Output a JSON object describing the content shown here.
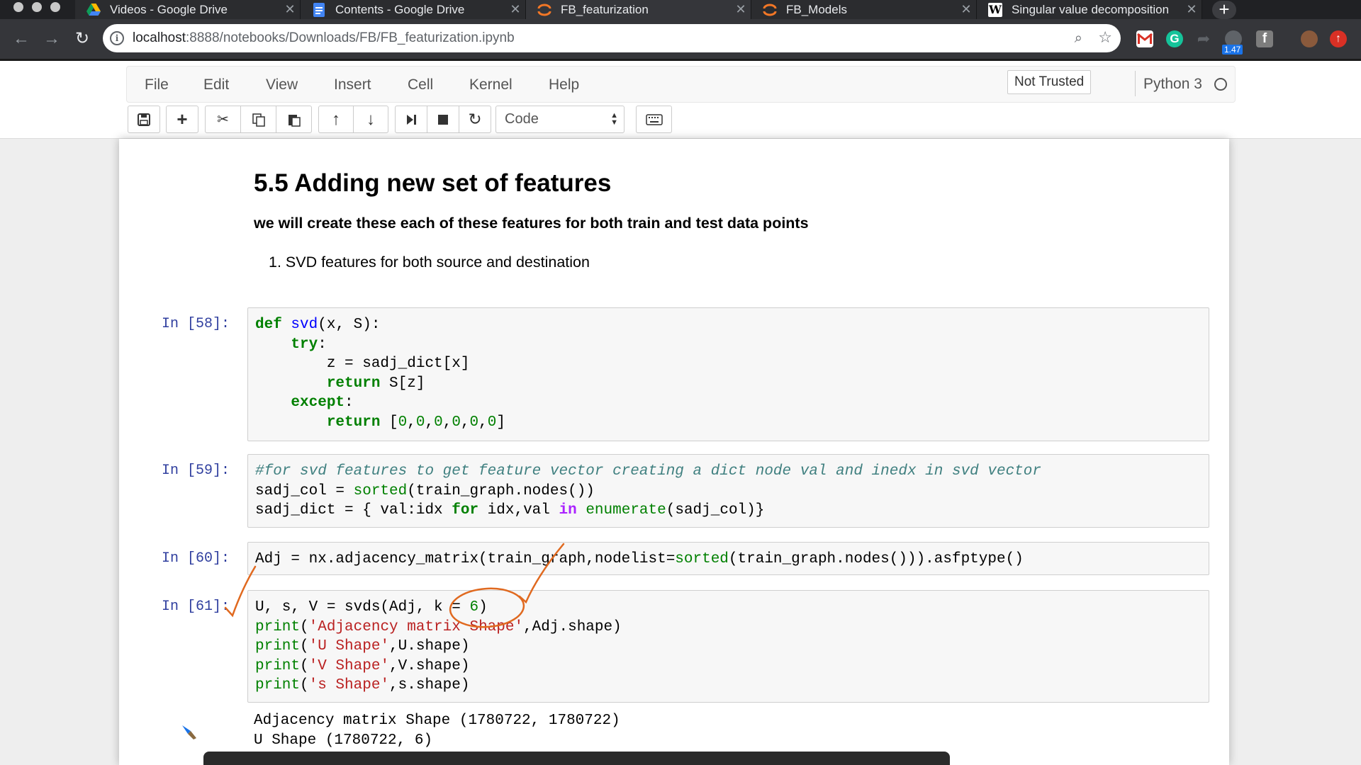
{
  "browser": {
    "tabs": [
      {
        "title": "Videos - Google Drive",
        "icon": "google-drive-icon",
        "active": false
      },
      {
        "title": "Contents - Google Drive",
        "icon": "google-docs-icon",
        "active": false
      },
      {
        "title": "FB_featurization",
        "icon": "jupyter-icon",
        "active": true
      },
      {
        "title": "FB_Models",
        "icon": "jupyter-icon",
        "active": false
      },
      {
        "title": "Singular value decomposition",
        "icon": "wikipedia-icon",
        "active": false
      }
    ],
    "url_host": "localhost",
    "url_rest": ":8888/notebooks/Downloads/FB/FB_featurization.ipynb",
    "extension_badge": "1.47"
  },
  "jupyter": {
    "menu": [
      "File",
      "Edit",
      "View",
      "Insert",
      "Cell",
      "Kernel",
      "Help"
    ],
    "trusted_label": "Not Trusted",
    "kernel_name": "Python 3",
    "cell_type": "Code"
  },
  "markdown": {
    "heading": "5.5 Adding new set of features",
    "bold_text": "we will create these each of these features for both train and test data points",
    "list_item": "1. SVD features for both source and destination"
  },
  "cells": [
    {
      "prompt": "In [58]:",
      "lines": [
        [
          [
            "kw",
            "def"
          ],
          [
            "t",
            " "
          ],
          [
            "fn",
            "svd"
          ],
          [
            "t",
            "(x, S):"
          ]
        ],
        [
          [
            "t",
            "    "
          ],
          [
            "kw",
            "try"
          ],
          [
            "t",
            ":"
          ]
        ],
        [
          [
            "t",
            "        z = sadj_dict[x]"
          ]
        ],
        [
          [
            "t",
            "        "
          ],
          [
            "kw",
            "return"
          ],
          [
            "t",
            " S[z]"
          ]
        ],
        [
          [
            "t",
            "    "
          ],
          [
            "kw",
            "except"
          ],
          [
            "t",
            ":"
          ]
        ],
        [
          [
            "t",
            "        "
          ],
          [
            "kw",
            "return"
          ],
          [
            "t",
            " ["
          ],
          [
            "num",
            "0"
          ],
          [
            "t",
            ","
          ],
          [
            "num",
            "0"
          ],
          [
            "t",
            ","
          ],
          [
            "num",
            "0"
          ],
          [
            "t",
            ","
          ],
          [
            "num",
            "0"
          ],
          [
            "t",
            ","
          ],
          [
            "num",
            "0"
          ],
          [
            "t",
            ","
          ],
          [
            "num",
            "0"
          ],
          [
            "t",
            "]"
          ]
        ]
      ]
    },
    {
      "prompt": "In [59]:",
      "lines": [
        [
          [
            "cm",
            "#for svd features to get feature vector creating a dict node val and inedx in svd vector"
          ]
        ],
        [
          [
            "t",
            "sadj_col = "
          ],
          [
            "bi",
            "sorted"
          ],
          [
            "t",
            "(train_graph.nodes())"
          ]
        ],
        [
          [
            "t",
            "sadj_dict = { val:idx "
          ],
          [
            "kw",
            "for"
          ],
          [
            "t",
            " idx,val "
          ],
          [
            "op",
            "in"
          ],
          [
            "t",
            " "
          ],
          [
            "bi",
            "enumerate"
          ],
          [
            "t",
            "(sadj_col)}"
          ]
        ]
      ]
    },
    {
      "prompt": "In [60]:",
      "lines": [
        [
          [
            "t",
            "Adj = nx.adjacency_matrix(train_graph,nodelist="
          ],
          [
            "bi",
            "sorted"
          ],
          [
            "t",
            "(train_graph.nodes())).asfptype()"
          ]
        ]
      ]
    },
    {
      "prompt": "In [61]:",
      "lines": [
        [
          [
            "t",
            "U, s, V = svds(Adj, k = "
          ],
          [
            "num",
            "6"
          ],
          [
            "t",
            ")"
          ]
        ],
        [
          [
            "bi",
            "print"
          ],
          [
            "t",
            "("
          ],
          [
            "str",
            "'Adjacency matrix Shape'"
          ],
          [
            "t",
            ",Adj.shape)"
          ]
        ],
        [
          [
            "bi",
            "print"
          ],
          [
            "t",
            "("
          ],
          [
            "str",
            "'U Shape'"
          ],
          [
            "t",
            ",U.shape)"
          ]
        ],
        [
          [
            "bi",
            "print"
          ],
          [
            "t",
            "("
          ],
          [
            "str",
            "'V Shape'"
          ],
          [
            "t",
            ",V.shape)"
          ]
        ],
        [
          [
            "bi",
            "print"
          ],
          [
            "t",
            "("
          ],
          [
            "str",
            "'s Shape'"
          ],
          [
            "t",
            ",s.shape)"
          ]
        ]
      ]
    }
  ],
  "output_lines": [
    "Adjacency matrix Shape (1780722, 1780722)",
    "U Shape (1780722, 6)"
  ],
  "colors": {
    "annotation_ink": "#e0691f",
    "prompt_blue": "#303f9f"
  }
}
